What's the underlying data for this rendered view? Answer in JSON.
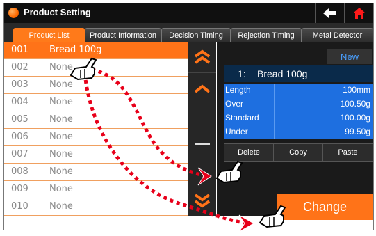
{
  "window": {
    "title": "Product Setting",
    "back_icon": "back-arrow-icon",
    "home_icon": "home-icon"
  },
  "tabs": [
    {
      "label": "Product List",
      "active": true
    },
    {
      "label": "Product Information",
      "active": false
    },
    {
      "label": "Decision Timing",
      "active": false
    },
    {
      "label": "Rejection Timing",
      "active": false
    },
    {
      "label": "Metal Detector",
      "active": false
    }
  ],
  "products": [
    {
      "num": "001",
      "name": "Bread 100g",
      "selected": true
    },
    {
      "num": "002",
      "name": "None",
      "selected": false
    },
    {
      "num": "003",
      "name": "None",
      "selected": false
    },
    {
      "num": "004",
      "name": "None",
      "selected": false
    },
    {
      "num": "005",
      "name": "None",
      "selected": false
    },
    {
      "num": "006",
      "name": "None",
      "selected": false
    },
    {
      "num": "007",
      "name": "None",
      "selected": false
    },
    {
      "num": "008",
      "name": "None",
      "selected": false
    },
    {
      "num": "009",
      "name": "None",
      "selected": false
    },
    {
      "num": "010",
      "name": "None",
      "selected": false
    }
  ],
  "scroll": {
    "top_icon": "double-chevron-up-icon",
    "up_icon": "chevron-up-icon",
    "mid_icon": "scroll-thumb-icon",
    "down_icon": "chevron-down-icon",
    "bottom_icon": "double-chevron-down-icon"
  },
  "detail": {
    "new_label": "New",
    "selected_index": "1:",
    "selected_name": "Bread 100g",
    "rows": [
      {
        "label": "Length",
        "value": "100mm"
      },
      {
        "label": "Over",
        "value": "100.50g"
      },
      {
        "label": "Standard",
        "value": "100.00g"
      },
      {
        "label": "Under",
        "value": "99.50g"
      }
    ],
    "delete_label": "Delete",
    "copy_label": "Copy",
    "paste_label": "Paste",
    "change_label": "Change"
  },
  "annotations": {
    "hand_icon": "pointing-hand-icon",
    "arrow_icon": "red-arrowhead-icon",
    "path_style": "dotted-red"
  },
  "colors": {
    "accent": "#ff7318",
    "detail_blue": "#1e6fe0",
    "new_blue": "#4aa0ff",
    "dark_bg": "#1a1a1a",
    "annotation_red": "#e8001a"
  }
}
